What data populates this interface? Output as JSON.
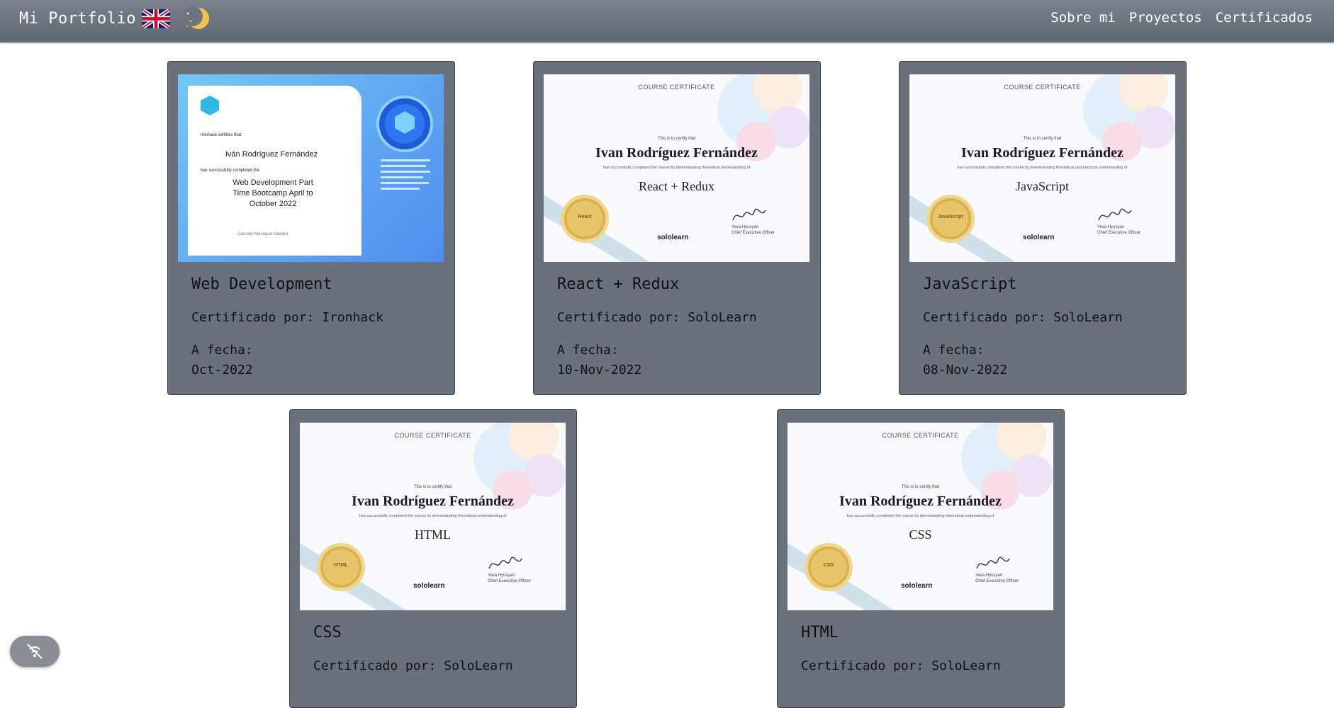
{
  "nav": {
    "brand": "Mi Portfolio",
    "links": [
      "Sobre mi",
      "Proyectos",
      "Certificados"
    ]
  },
  "icons": {
    "flag": "uk-flag-icon",
    "theme": "moon-sun-icon",
    "accessibility": "accessibility-icon"
  },
  "labels": {
    "by_prefix": "Certificado por:",
    "date_label": "A fecha:"
  },
  "certificates": [
    {
      "title": "Web Development",
      "by": "Certificado por: Ironhack",
      "date_label": "A fecha:",
      "date": "Oct-2022",
      "image": {
        "brand": "IRON HACK",
        "certifies": "Ironhack certifies that:",
        "name": "Iván Rodríguez Fernández",
        "completed": "has successfully completed the",
        "course": "Web Development Part Time Bootcamp April to October 2022",
        "signer": "Gonzalo Manrique Sabatel",
        "badge": "IRONHACK SCHOOL WEB DEVELOPMENT"
      }
    },
    {
      "title": "React + Redux",
      "by": "Certificado por: SoloLearn",
      "date_label": "A fecha:",
      "date": "10-Nov-2022",
      "image": {
        "header": "COURSE CERTIFICATE",
        "pre": "This is to certify that",
        "name": "Ivan Rodríguez Fernández",
        "desc": "has successfully completed the course by demonstrating theoretical understanding of",
        "course": "React + Redux",
        "seal": "React",
        "brand": "sololearn",
        "signer": "Yeva Hyusyan",
        "signer_title": "Chief Executive Officer"
      }
    },
    {
      "title": "JavaScript",
      "by": "Certificado por: SoloLearn",
      "date_label": "A fecha:",
      "date": "08-Nov-2022",
      "image": {
        "header": "COURSE CERTIFICATE",
        "pre": "This is to certify that",
        "name": "Ivan Rodríguez Fernández",
        "desc": "has successfully completed the course by demonstrating theoretical and practical understanding of",
        "course": "JavaScript",
        "seal": "JavaScript",
        "brand": "sololearn",
        "signer": "Yeva Hyusyan",
        "signer_title": "Chief Executive Officer"
      }
    },
    {
      "title": "CSS",
      "by": "Certificado por: SoloLearn",
      "date_label": "A fecha:",
      "date": "",
      "image": {
        "header": "COURSE CERTIFICATE",
        "pre": "This is to certify that",
        "name": "Ivan Rodríguez Fernández",
        "desc": "has successfully completed the course by demonstrating theoretical understanding of",
        "course": "HTML",
        "seal": "HTML",
        "brand": "sololearn",
        "signer": "Yeva Hyusyan",
        "signer_title": "Chief Executive Officer"
      }
    },
    {
      "title": "HTML",
      "by": "Certificado por: SoloLearn",
      "date_label": "A fecha:",
      "date": "",
      "image": {
        "header": "COURSE CERTIFICATE",
        "pre": "This is to certify that",
        "name": "Ivan Rodríguez Fernández",
        "desc": "has successfully completed the course by demonstrating theoretical understanding of",
        "course": "CSS",
        "seal": "CSS",
        "brand": "sololearn",
        "signer": "Yeva Hyusyan",
        "signer_title": "Chief Executive Officer"
      }
    }
  ],
  "colors": {
    "navbar": "#6b737d",
    "card": "#6b717c",
    "card_border": "#3a3f47",
    "ironhack_blue": "#4f8df0",
    "seal_gold": "#e8c46a"
  }
}
